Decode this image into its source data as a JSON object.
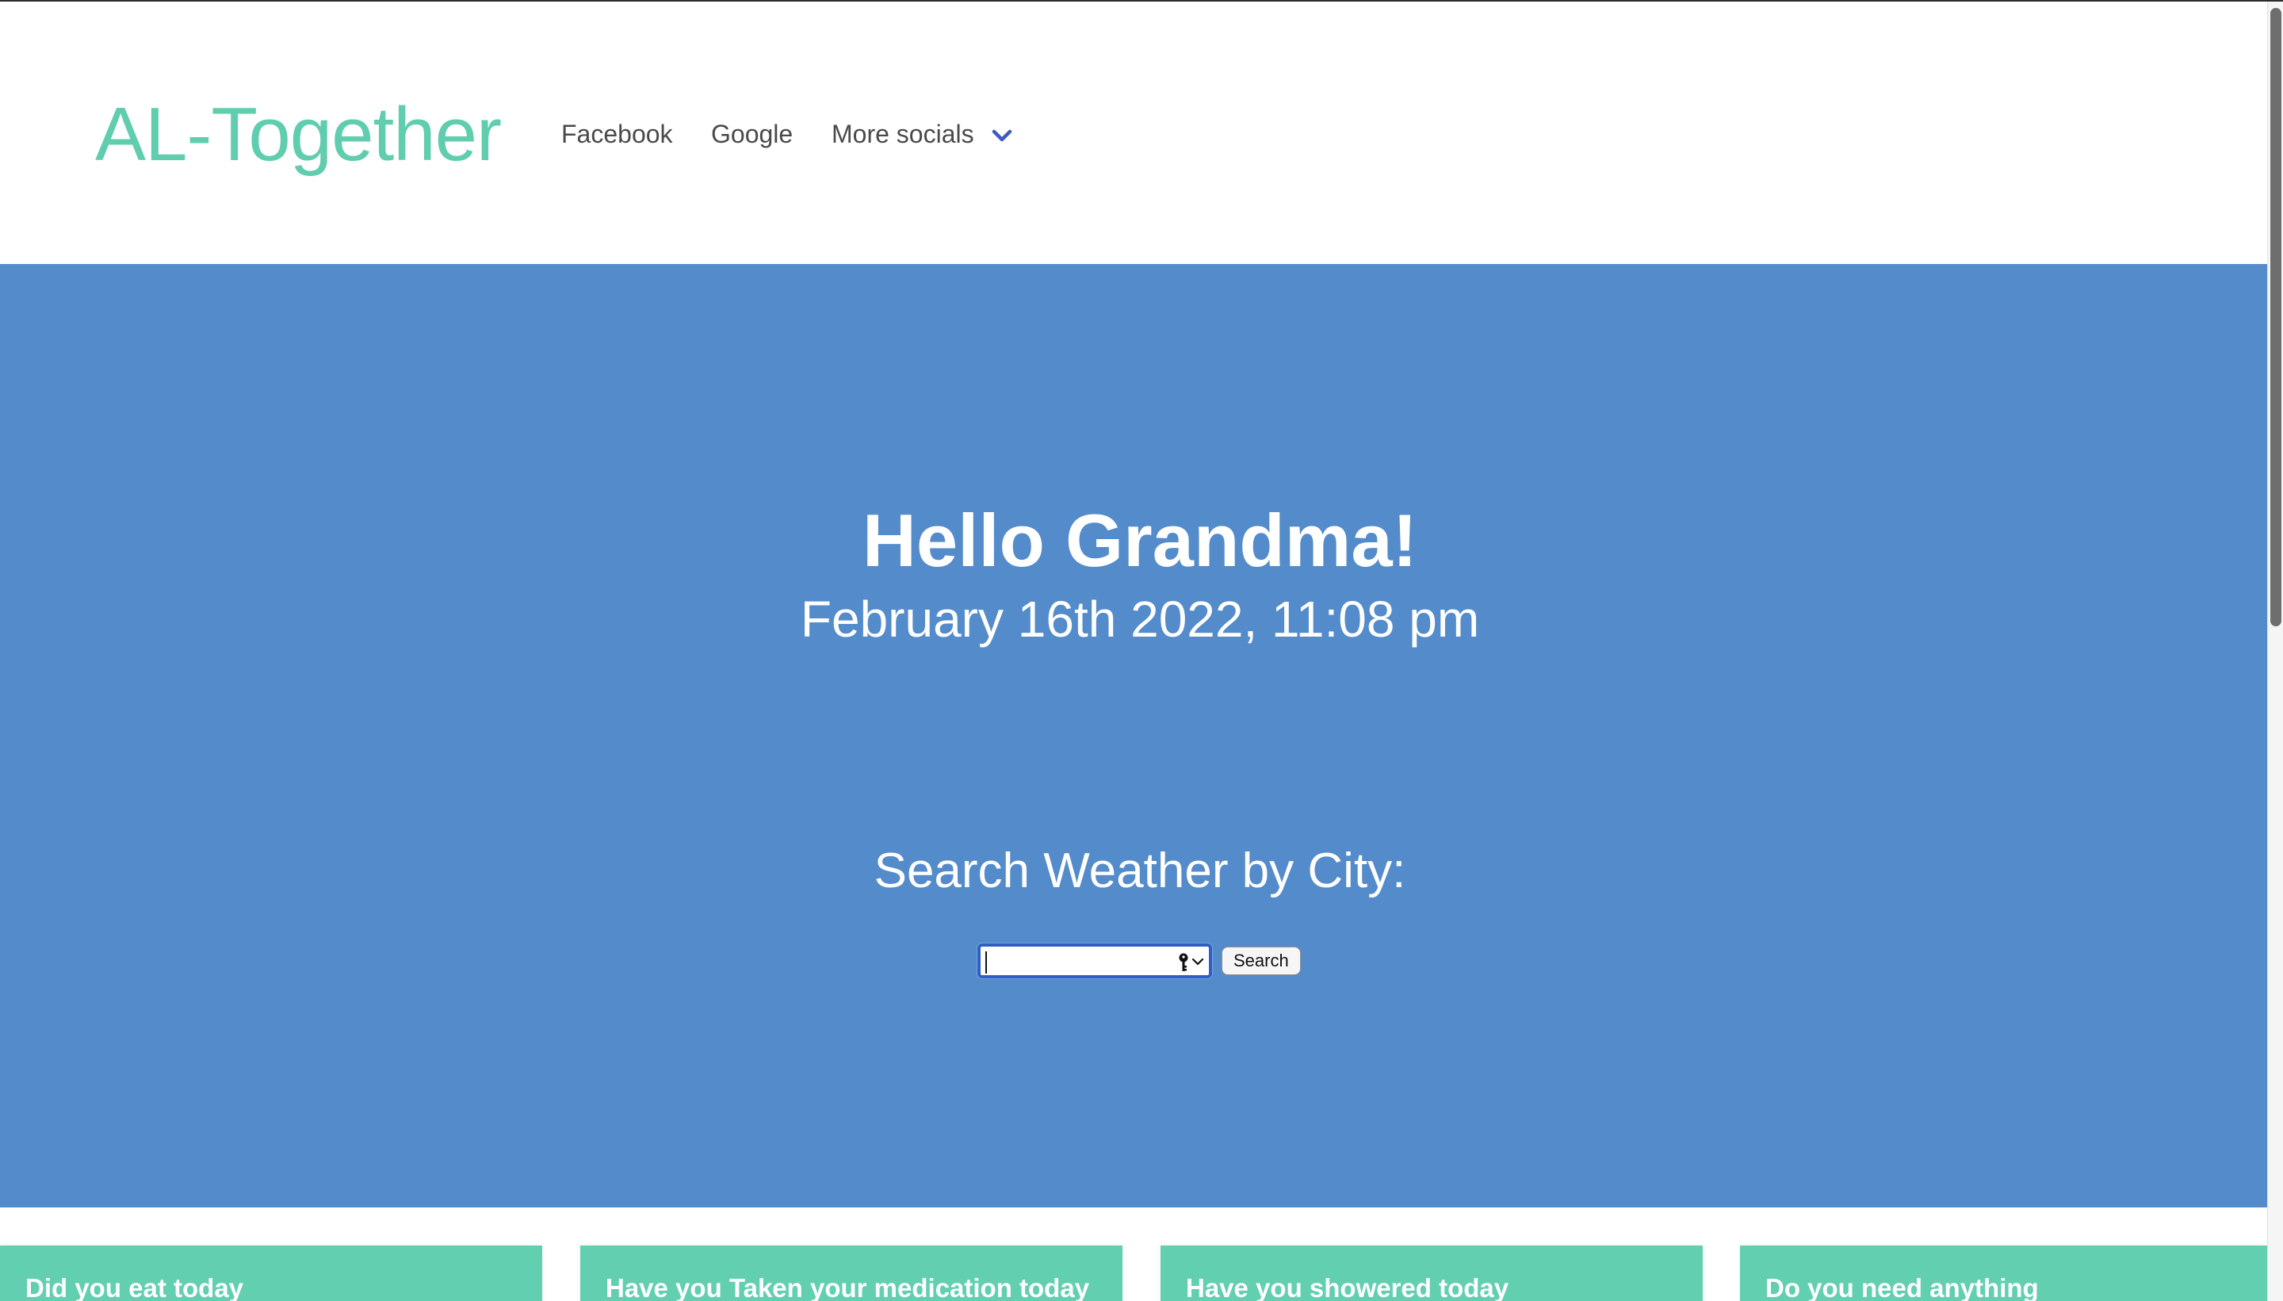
{
  "navbar": {
    "brand": "AL-Together",
    "links": [
      "Facebook",
      "Google"
    ],
    "more_label": "More socials",
    "more_icon": "chevron-down-icon",
    "brand_color": "#5fcdae"
  },
  "hero": {
    "title": "Hello Grandma!",
    "datetime": "February 16th 2022, 11:08 pm",
    "weather_heading": "Search Weather by City:",
    "search_input": {
      "value": "",
      "placeholder": "",
      "icons": [
        "key-icon",
        "dropdown-arrow-icon"
      ]
    },
    "search_button_label": "Search",
    "background_color": "#548bca"
  },
  "cards": [
    {
      "title": "Did you eat today"
    },
    {
      "title": "Have you Taken your medication today"
    },
    {
      "title": "Have you showered today"
    },
    {
      "title": "Do you need anything"
    }
  ],
  "card_color": "#63cfb1"
}
